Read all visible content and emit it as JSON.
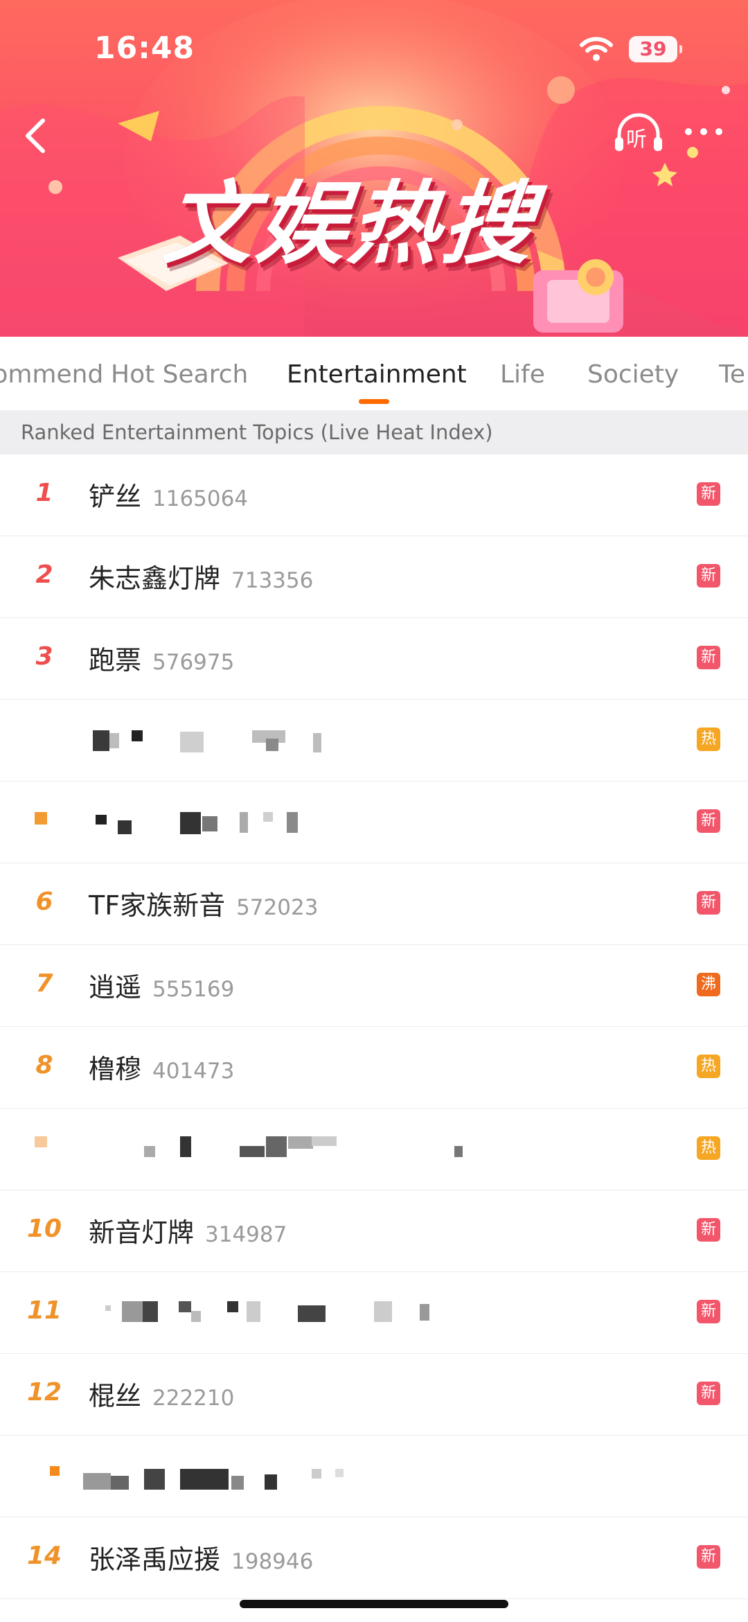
{
  "status_bar": {
    "time": "16:48",
    "battery": "39"
  },
  "banner": {
    "title": "文娱热搜",
    "listen_label": "听",
    "back_icon": "chevron-left-icon",
    "more_icon": "more-dots-icon",
    "colors": {
      "top": "#ff6a5e",
      "bottom": "#f2456c"
    }
  },
  "tabs": [
    {
      "label": "Recommend"
    },
    {
      "label": "Hot Search"
    },
    {
      "label": "Entertainment",
      "active": true
    },
    {
      "label": "Life"
    },
    {
      "label": "Society"
    },
    {
      "label": "Te"
    }
  ],
  "accent_color": "#ff6a00",
  "section_header": "Ranked Entertainment Topics (Live Heat Index)",
  "badges": {
    "new": "新",
    "hot": "热",
    "boil": "沸"
  },
  "rows": [
    {
      "rank": "1",
      "topic": "铲丝",
      "heat": "1165064",
      "badge": "新"
    },
    {
      "rank": "2",
      "topic": "朱志鑫灯牌",
      "heat": "713356",
      "badge": "新"
    },
    {
      "rank": "3",
      "topic": "跑票",
      "heat": "576975",
      "badge": "新"
    },
    {
      "rank": "",
      "topic": "",
      "heat": "",
      "badge": "热",
      "pixelated": true
    },
    {
      "rank": "",
      "topic": "",
      "heat": "",
      "badge": "新",
      "pixelated": true
    },
    {
      "rank": "6",
      "topic": "TF家族新音",
      "heat": "572023",
      "badge": "新"
    },
    {
      "rank": "7",
      "topic": "逍遥",
      "heat": "555169",
      "badge": "沸"
    },
    {
      "rank": "8",
      "topic": "橹穆",
      "heat": "401473",
      "badge": "热"
    },
    {
      "rank": "",
      "topic": "",
      "heat": "",
      "badge": "热",
      "pixelated": true
    },
    {
      "rank": "10",
      "topic": "新音灯牌",
      "heat": "314987",
      "badge": "新"
    },
    {
      "rank": "11",
      "topic": "",
      "heat": "",
      "badge": "新",
      "pixelated": true
    },
    {
      "rank": "12",
      "topic": "棍丝",
      "heat": "222210",
      "badge": "新"
    },
    {
      "rank": "",
      "topic": "",
      "heat": "",
      "badge": "",
      "pixelated": true
    },
    {
      "rank": "14",
      "topic": "张泽禹应援",
      "heat": "198946",
      "badge": "新"
    }
  ]
}
